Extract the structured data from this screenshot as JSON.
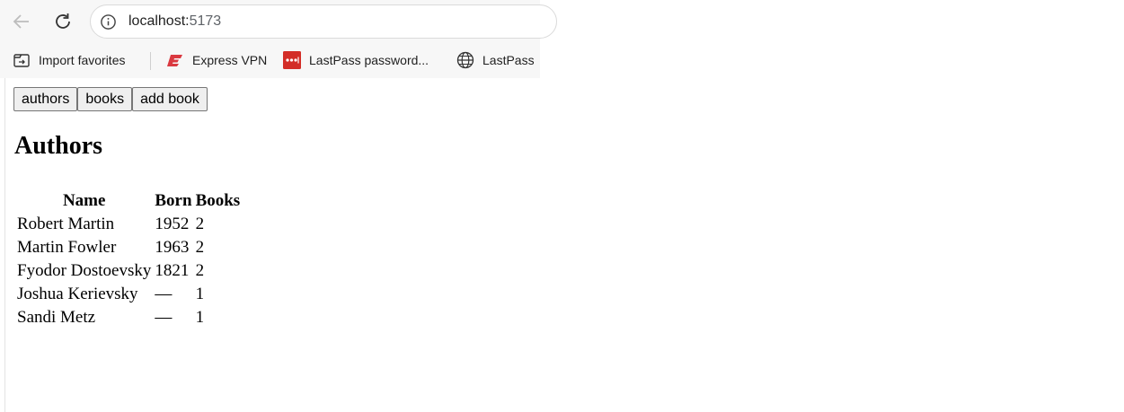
{
  "browser": {
    "url_host": "localhost:",
    "url_port": "5173",
    "bookmarks": [
      {
        "label": "Import favorites",
        "icon": "import-icon"
      },
      {
        "label": "Express VPN",
        "icon": "expressvpn-icon"
      },
      {
        "label": "LastPass password...",
        "icon": "lastpass-icon"
      },
      {
        "label": "LastPass",
        "icon": "globe-icon"
      }
    ]
  },
  "nav": {
    "authors_label": "authors",
    "books_label": "books",
    "add_book_label": "add book"
  },
  "authors": {
    "heading": "Authors",
    "columns": [
      "Name",
      "Born",
      "Books"
    ],
    "rows": [
      {
        "name": "Robert Martin",
        "born": "1952",
        "books": "2"
      },
      {
        "name": "Martin Fowler",
        "born": "1963",
        "books": "2"
      },
      {
        "name": "Fyodor Dostoevsky",
        "born": "1821",
        "books": "2"
      },
      {
        "name": "Joshua Kerievsky",
        "born": "—",
        "books": "1"
      },
      {
        "name": "Sandi Metz",
        "born": "—",
        "books": "1"
      }
    ]
  },
  "colors": {
    "expressvpn": "#da3940",
    "lastpass": "#d32d27"
  }
}
